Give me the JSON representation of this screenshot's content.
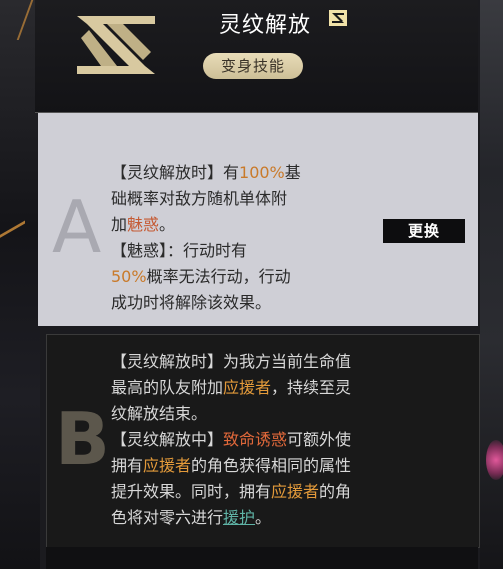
{
  "header": {
    "title": "灵纹解放",
    "tag": "变身技能"
  },
  "option_a": {
    "letter": "A",
    "lines": [
      [
        {
          "t": "【灵纹解放时】有"
        },
        {
          "t": "100%",
          "c": "hl-orange"
        },
        {
          "t": "基"
        }
      ],
      [
        {
          "t": "础概率对敌方随机单体附"
        }
      ],
      [
        {
          "t": "加"
        },
        {
          "t": "魅惑",
          "c": "hl-red"
        },
        {
          "t": "。"
        }
      ],
      [
        {
          "t": "【魅惑】：行动时有"
        }
      ],
      [
        {
          "t": "50%",
          "c": "hl-orange"
        },
        {
          "t": "概率无法行动，行动"
        }
      ],
      [
        {
          "t": "成功时将解除该效果。"
        }
      ]
    ],
    "swap_label": "更换"
  },
  "option_b": {
    "letter": "B",
    "lines": [
      [
        {
          "t": "【灵纹解放时】为我方当前生命值"
        }
      ],
      [
        {
          "t": "最高的队友附加"
        },
        {
          "t": "应援者",
          "c": "b-orange"
        },
        {
          "t": "，持续至灵"
        }
      ],
      [
        {
          "t": "纹解放结束。"
        }
      ],
      [
        {
          "t": "【灵纹解放中】"
        },
        {
          "t": "致命诱惑",
          "c": "b-red"
        },
        {
          "t": "可额外使"
        }
      ],
      [
        {
          "t": "拥有"
        },
        {
          "t": "应援者",
          "c": "b-orange"
        },
        {
          "t": "的角色获得相同的属性"
        }
      ],
      [
        {
          "t": "提升效果。同时，拥有"
        },
        {
          "t": "应援者",
          "c": "b-orange"
        },
        {
          "t": "的角"
        }
      ],
      [
        {
          "t": "色将对零六进行"
        },
        {
          "t": "援护",
          "c": "b-teal"
        },
        {
          "t": "。"
        }
      ]
    ]
  },
  "colors": {
    "accent_orange": "#c97a2a",
    "accent_teal": "#5fb3a6",
    "tag_bg": "#e8dcb8"
  },
  "icons": [
    "skill-emblem-icon",
    "rank-emblem-icon"
  ]
}
